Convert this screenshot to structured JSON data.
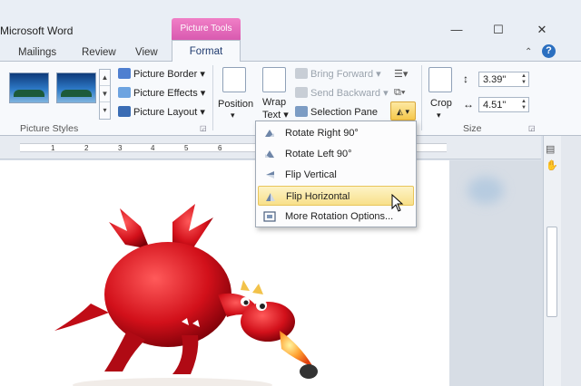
{
  "window": {
    "title": "Microsoft Word",
    "contextual_tab_group": "Picture Tools",
    "controls": {
      "minimize": "—",
      "maximize": "☐",
      "close": "✕"
    }
  },
  "tabs": [
    {
      "label": "Mailings"
    },
    {
      "label": "Review"
    },
    {
      "label": "View"
    }
  ],
  "active_tab": "Format",
  "ribbon": {
    "picture_styles": {
      "group_label": "Picture Styles",
      "picture_border": "Picture Border",
      "picture_effects": "Picture Effects",
      "picture_layout": "Picture Layout"
    },
    "arrange": {
      "position": "Position",
      "wrap_text_line1": "Wrap",
      "wrap_text_line2": "Text",
      "bring_forward": "Bring Forward",
      "send_backward": "Send Backward",
      "selection_pane": "Selection Pane"
    },
    "size": {
      "group_label": "Size",
      "crop": "Crop",
      "height": "3.39\"",
      "width": "4.51\""
    }
  },
  "rotate_menu": {
    "items": [
      {
        "label": "Rotate Right 90°",
        "highlighted": false
      },
      {
        "label": "Rotate Left 90°",
        "highlighted": false
      },
      {
        "label": "Flip Vertical",
        "highlighted": false
      },
      {
        "label": "Flip Horizontal",
        "highlighted": true
      },
      {
        "label": "More Rotation Options...",
        "highlighted": false
      }
    ]
  },
  "ruler": {
    "numbers": [
      "1",
      "2",
      "3",
      "4",
      "5",
      "6"
    ]
  },
  "colors": {
    "contextual_tab": "#e35fb6",
    "highlight": "#f8e08a",
    "dragon_red": "#d2101a"
  }
}
